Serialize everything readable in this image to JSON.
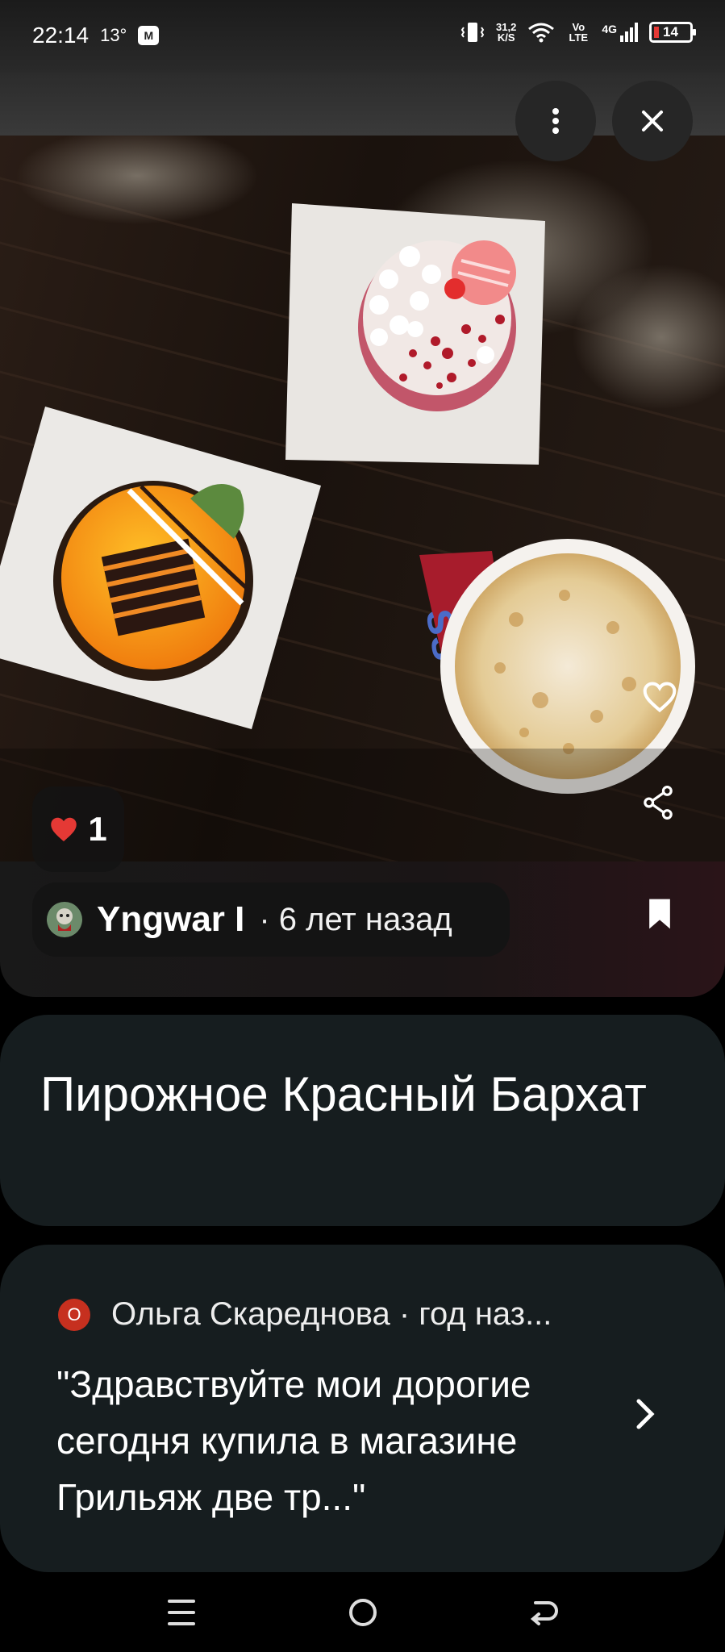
{
  "status_bar": {
    "time": "22:14",
    "temperature": "13°",
    "app_badge": "M",
    "net_speed_value": "31,2",
    "net_speed_unit": "K/S",
    "volte": "Vo LTE",
    "network": "4G",
    "battery": "14",
    "battery_color": "#e53935"
  },
  "toolbar": {
    "more_icon": "more-vertical-icon",
    "close_icon": "close-icon"
  },
  "photo": {
    "description_icon": "photo",
    "like_count": "1",
    "like_icon": "heart-filled-icon",
    "like_color": "#e53935",
    "author_name": "Yngwar I",
    "author_time": "· 6 лет назад"
  },
  "title": "Пирожное Красный Бархат",
  "review": {
    "avatar_letter": "О",
    "author_line": "Ольга Скареднова · год наз...",
    "text": "\"Здравствуйте мои дорогие сегодня купила в магазине Грильяж две тр...\""
  },
  "colors": {
    "card_bg": "#161d1f",
    "accent_red": "#c6301f"
  }
}
